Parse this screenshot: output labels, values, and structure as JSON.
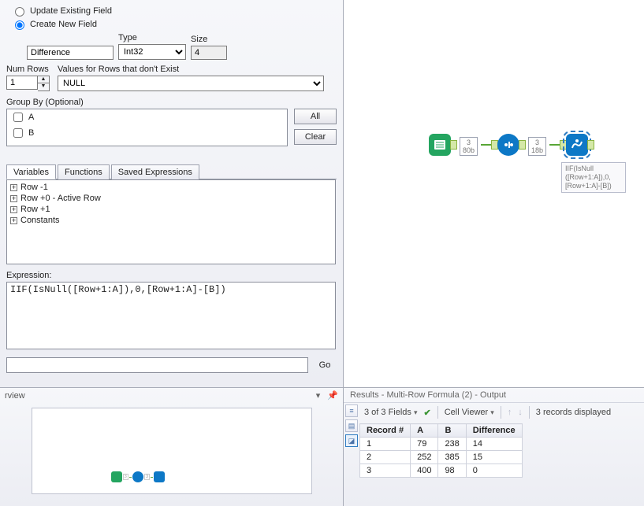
{
  "config": {
    "radio_update": "Update Existing Field",
    "radio_create": "Create New Field",
    "fieldname": "Difference",
    "type_label": "Type",
    "type_value": "Int32",
    "size_label": "Size",
    "size_value": "4",
    "numrows_label": "Num Rows",
    "numrows_value": "1",
    "values_label": "Values for Rows that don't Exist",
    "values_value": "NULL",
    "groupby_label": "Group By (Optional)",
    "groupby_items": [
      "A",
      "B"
    ],
    "btn_all": "All",
    "btn_clear": "Clear"
  },
  "tabs": {
    "variables": "Variables",
    "functions": "Functions",
    "saved": "Saved Expressions"
  },
  "tree": [
    "Row -1",
    "Row +0 - Active Row",
    "Row +1",
    "Constants"
  ],
  "expression": {
    "label": "Expression:",
    "value": "IIF(IsNull([Row+1:A]),0,[Row+1:A]-[B])"
  },
  "go": "Go",
  "canvas": {
    "anno1_line1": "3",
    "anno1_line2": "80b",
    "anno2_line1": "3",
    "anno2_line2": "18b",
    "formula_l1": "IIF(IsNull",
    "formula_l2": "([Row+1:A]),0,",
    "formula_l3": "[Row+1:A]-[B])"
  },
  "overview": {
    "title": "rview"
  },
  "results": {
    "title": "Results - Multi-Row Formula (2) - Output",
    "fields": "3 of 3 Fields",
    "cellviewer": "Cell Viewer",
    "records": "3 records displayed",
    "columns": [
      "Record #",
      "A",
      "B",
      "Difference"
    ],
    "rows": [
      {
        "rec": "1",
        "A": "79",
        "B": "238",
        "Difference": "14"
      },
      {
        "rec": "2",
        "A": "252",
        "B": "385",
        "Difference": "15"
      },
      {
        "rec": "3",
        "A": "400",
        "B": "98",
        "Difference": "0"
      }
    ]
  },
  "chart_data": {
    "type": "table",
    "title": "Results - Multi-Row Formula (2) - Output",
    "columns": [
      "Record #",
      "A",
      "B",
      "Difference"
    ],
    "rows": [
      [
        1,
        79,
        238,
        14
      ],
      [
        2,
        252,
        385,
        15
      ],
      [
        3,
        400,
        98,
        0
      ]
    ]
  }
}
